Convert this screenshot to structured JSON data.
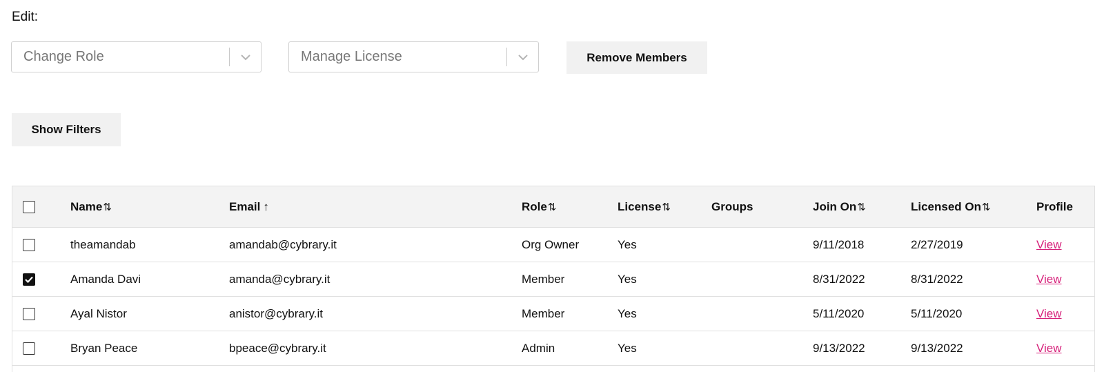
{
  "edit_label": "Edit:",
  "controls": {
    "change_role_placeholder": "Change Role",
    "manage_license_placeholder": "Manage License",
    "remove_members_label": "Remove Members",
    "show_filters_label": "Show Filters"
  },
  "table": {
    "columns": {
      "name": "Name",
      "email": "Email",
      "role": "Role",
      "license": "License",
      "groups": "Groups",
      "join_on": "Join On",
      "licensed_on": "Licensed On",
      "profile": "Profile"
    },
    "sort_icon": "⇅",
    "sort_asc_icon": "↑",
    "rows": [
      {
        "checked": false,
        "name": "theamandab",
        "email": "amandab@cybrary.it",
        "role": "Org Owner",
        "license": "Yes",
        "groups": "",
        "join_on": "9/11/2018",
        "licensed_on": "2/27/2019",
        "profile": "View"
      },
      {
        "checked": true,
        "name": "Amanda Davi",
        "email": "amanda@cybrary.it",
        "role": "Member",
        "license": "Yes",
        "groups": "",
        "join_on": "8/31/2022",
        "licensed_on": "8/31/2022",
        "profile": "View"
      },
      {
        "checked": false,
        "name": "Ayal Nistor",
        "email": "anistor@cybrary.it",
        "role": "Member",
        "license": "Yes",
        "groups": "",
        "join_on": "5/11/2020",
        "licensed_on": "5/11/2020",
        "profile": "View"
      },
      {
        "checked": false,
        "name": "Bryan Peace",
        "email": "bpeace@cybrary.it",
        "role": "Admin",
        "license": "Yes",
        "groups": "",
        "join_on": "9/13/2022",
        "licensed_on": "9/13/2022",
        "profile": "View"
      }
    ]
  },
  "colors": {
    "link": "#d6207a",
    "header_bg": "#f3f3f3",
    "button_bg": "#f1f1f1"
  }
}
